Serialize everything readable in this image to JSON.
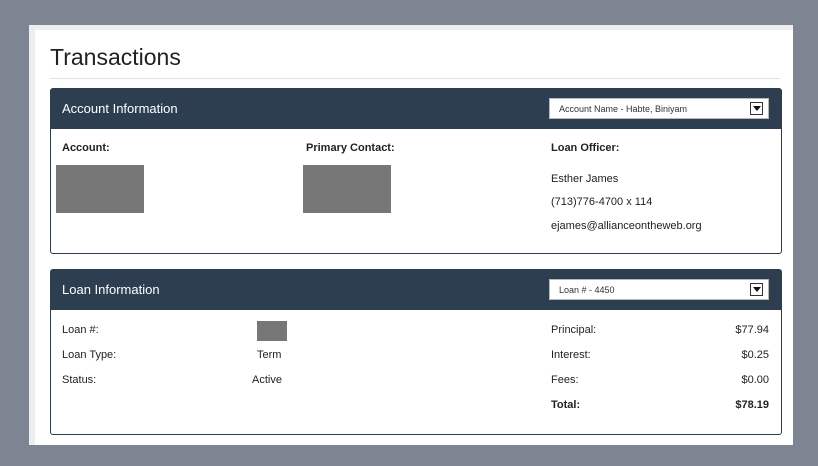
{
  "page": {
    "title": "Transactions"
  },
  "account_panel": {
    "title": "Account Information",
    "selector_value": "Account Name - Habte, Biniyam",
    "account_label": "Account:",
    "contact_label": "Primary Contact:",
    "officer_label": "Loan Officer:",
    "officer": {
      "name": "Esther James",
      "phone": "(713)776-4700 x 114",
      "email": "ejames@allianceontheweb.org"
    }
  },
  "loan_panel": {
    "title": "Loan Information",
    "selector_value": "Loan # - 4450",
    "fields": {
      "loan_no_label": "Loan #:",
      "loan_type_label": "Loan Type:",
      "loan_type_value": "Term",
      "status_label": "Status:",
      "status_value": "Active"
    },
    "summary": {
      "principal_label": "Principal:",
      "principal_value": "$77.94",
      "interest_label": "Interest:",
      "interest_value": "$0.25",
      "fees_label": "Fees:",
      "fees_value": "$0.00",
      "total_label": "Total:",
      "total_value": "$78.19"
    }
  }
}
